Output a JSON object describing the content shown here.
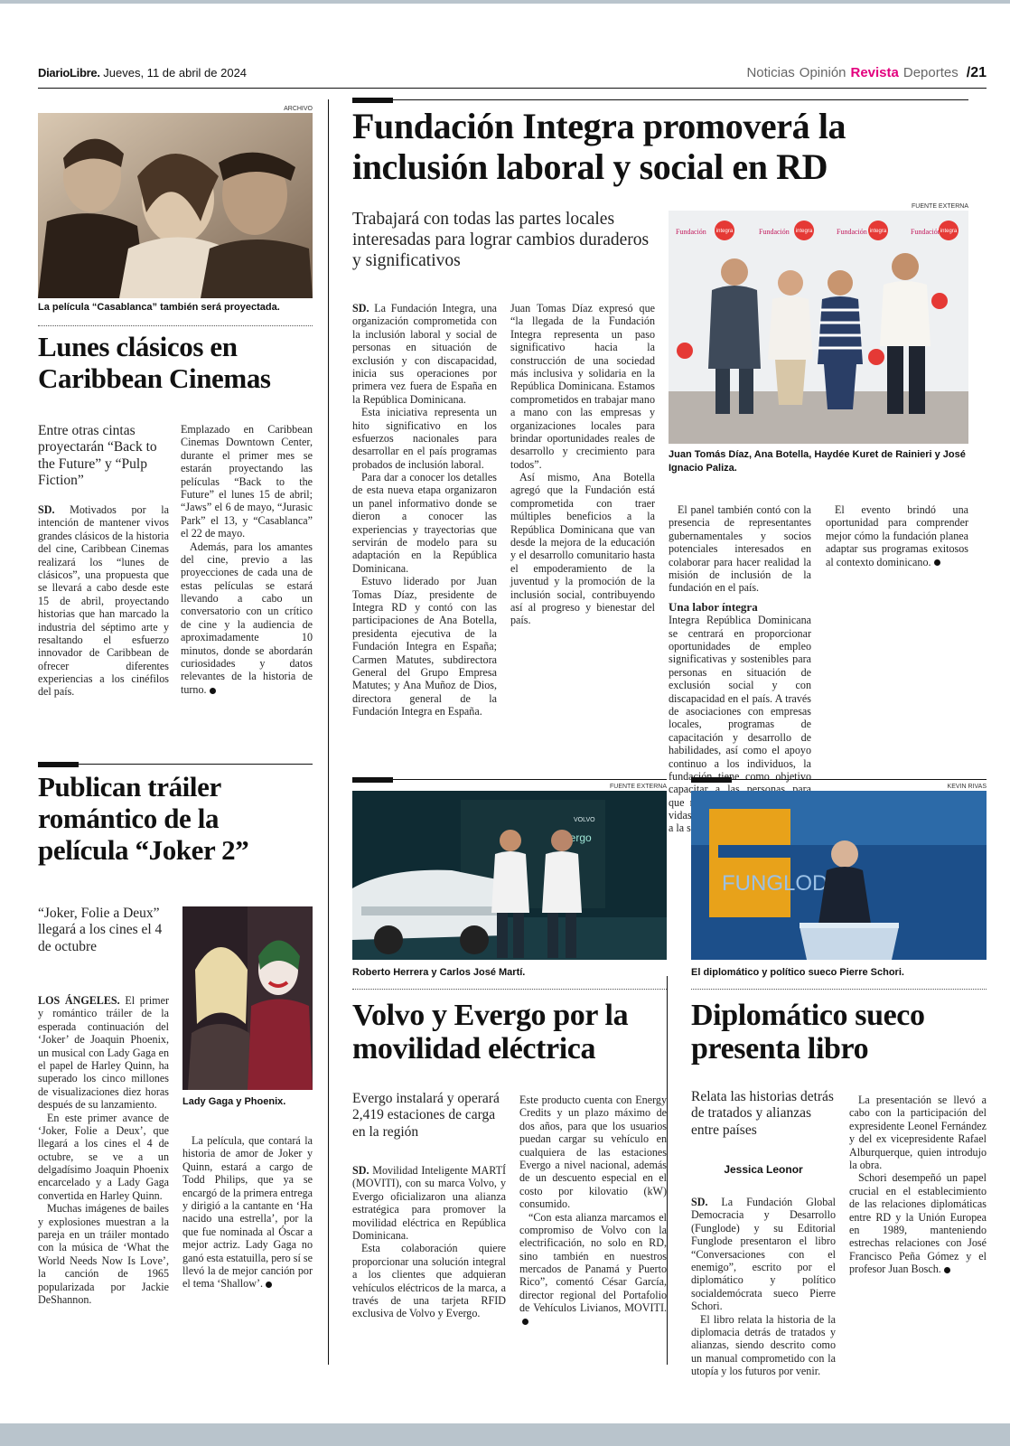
{
  "header": {
    "brand": "DiarioLibre.",
    "date": "Jueves, 11 de abril de 2024",
    "sections": [
      "Noticias",
      "Opinión",
      "Revista",
      "Deportes"
    ],
    "active_section": "Revista",
    "page": "/21"
  },
  "casablanca": {
    "credit": "ARCHIVO",
    "caption": "La película “Casablanca” también será proyectada.",
    "headline": "Lunes clásicos en Caribbean Cinemas",
    "deck": "Entre otras cintas proyectarán “Back to the Future” y “Pulp Fiction”",
    "dateline": "SD.",
    "p1": "Motivados por la intención de mantener vivos grandes clásicos de la historia del cine, Caribbean Cinemas realizará los “lunes de clásicos”, una propuesta que se llevará a cabo desde este 15 de abril, proyectando historias que han marcado la industria del séptimo arte y resaltando el esfuerzo innovador de Caribbean de ofrecer diferentes experiencias a los cinéfilos del país.",
    "p2": "Emplazado en Caribbean Cinemas Downtown Center, durante el primer mes se estarán proyectando las películas “Back to the Future” el lunes 15 de abril; “Jaws” el 6 de mayo, “Jurasic Park” el 13, y “Casablanca” el 22 de mayo.",
    "p3": "Además, para los amantes del cine, previo a las proyecciones de cada una de estas películas se estará llevando a cabo un conversatorio con un crítico de cine y la audiencia de aproximadamente 10 minutos, donde se abordarán curiosidades y datos relevantes de la historia de turno."
  },
  "integra": {
    "headline": "Fundación Integra promoverá la inclusión laboral y social en RD",
    "deck": "Trabajará con todas las partes locales interesadas para lograr cambios duraderos y significativos",
    "credit": "FUENTE EXTERNA",
    "caption": "Juan Tomás Díaz, Ana Botella, Haydée Kuret de Rainieri y José Ignacio Paliza.",
    "dateline": "SD.",
    "p1": "La Fundación Integra, una organización comprometida con la inclusión laboral y social de personas en situación de exclusión y con discapacidad, inicia sus operaciones por primera vez fuera de España en la República Dominicana.",
    "p2": "Esta iniciativa representa un hito significativo en los esfuerzos nacionales para desarrollar en el país programas probados de inclusión laboral.",
    "p3": "Para dar a conocer los detalles de esta nueva etapa organizaron un panel informativo donde se dieron a conocer las experiencias y trayectorias que servirán de modelo para su adaptación en la República Dominicana.",
    "p4": "Estuvo liderado por Juan Tomas Díaz, presidente de Integra RD y contó con las participaciones de Ana Botella, presidenta ejecutiva de la Fundación Integra en España; Carmen Matutes, subdirectora General del Grupo Empresa Matutes; y Ana Muñoz de Dios, directora general de la Fundación Integra en España.",
    "p5": "Juan Tomas Díaz expresó que “la llegada de la Fundación Integra representa un paso significativo hacia la construcción de una sociedad más inclusiva y solidaria en la República Dominicana. Estamos comprometidos en trabajar mano a mano con las empresas y organizaciones locales para brindar oportunidades reales de desarrollo y crecimiento para todos”.",
    "p6": "Así mismo, Ana Botella agregó que la Fundación está comprometida con traer múltiples beneficios a la República Dominicana que van desde la mejora de la educación y el desarrollo comunitario hasta el empoderamiento de la juventud y la promoción de la inclusión social, contribuyendo así al progreso y bienestar del país.",
    "p7": "El panel también contó con la presencia de representantes gubernamentales y socios potenciales interesados en colaborar para hacer realidad la misión de inclusión de la fundación en el país.",
    "subhead": "Una labor íntegra",
    "p8": "Integra República Dominicana se centrará en proporcionar oportunidades de empleo significativas y sostenibles para personas en situación de exclusión social y con discapacidad en el país. A través de asociaciones con empresas locales, programas de capacitación y desarrollo de habilidades, así como el apoyo continuo a los individuos, la fundación tiene como objetivo capacitar a las personas para que retomen el control de sus vidas y contribuyan activamente a la sociedad.",
    "p9": "El evento brindó una oportunidad para comprender mejor cómo la fundación planea adaptar sus programas exitosos al contexto dominicano.",
    "banner_word": "Fundación",
    "logo_word": "integra"
  },
  "joker": {
    "headline": "Publican tráiler romántico de la película “Joker 2”",
    "deck": "“Joker, Folie a Deux” llegará a los cines el 4 de octubre",
    "caption": "Lady Gaga y Phoenix.",
    "dateline": "LOS ÁNGELES.",
    "p1": "El primer y romántico tráiler de la esperada continuación del ‘Joker’ de Joaquin Phoenix, un musical con Lady Gaga en el papel de Harley Quinn, ha superado los cinco millones de visualizaciones diez horas después de su lanzamiento.",
    "p2": "En este primer avance de ‘Joker, Folie a Deux’, que llegará a los cines el 4 de octubre, se ve a un delgadísimo Joaquin Phoenix encarcelado y a Lady Gaga convertida en Harley Quinn.",
    "p3": "Muchas imágenes de bailes y explosiones muestran a la pareja en un tráiler montado con la música de ‘What the World Needs Now Is Love’, la canción de 1965 popularizada por Jackie DeShannon.",
    "p4": "La película, que contará la historia de amor de Joker y Quinn, estará a cargo de Todd Philips, que ya se encargó de la primera entrega y dirigió a la cantante en ‘Ha nacido una estrella’, por la que fue nominada al Óscar a mejor actriz. Lady Gaga no ganó esta estatuilla, pero sí se llevó la de mejor canción por el tema ‘Shallow’."
  },
  "volvo": {
    "credit": "FUENTE EXTERNA",
    "caption": "Roberto Herrera y Carlos José Martí.",
    "headline": "Volvo y Evergo por la movilidad eléctrica",
    "deck": "Evergo instalará y operará 2,419 estaciones de carga en la región",
    "dateline": "SD.",
    "p1": "Movilidad Inteligente MARTÍ (MOVITI), con su marca Volvo, y Evergo oficializaron una alianza estratégica para promover la movilidad eléctrica en República Dominicana.",
    "p2": "Esta colaboración quiere proporcionar una solución integral a los clientes que adquieran vehículos eléctricos de la marca, a través de una tarjeta RFID exclusiva de Volvo y Evergo.",
    "p3": "Este producto cuenta con Energy Credits y un plazo máximo de dos años, para que los usuarios puedan cargar su vehículo en cualquiera de las estaciones Evergo a nivel nacional, además de un descuento especial en el costo por kilovatio (kW) consumido.",
    "p4": "“Con esta alianza marcamos el compromiso de Volvo con la electrificación, no solo en RD, sino también en nuestros mercados de Panamá y Puerto Rico”, comentó César García, director regional del Portafolio de Vehículos Livianos, MOVITI.",
    "sign_brand": "VOLVO",
    "sign_evergo": "evergo"
  },
  "schori": {
    "credit": "KEVIN RIVAS",
    "caption": "El diplomático y político sueco Pierre Schori.",
    "headline": "Diplomático sueco presenta libro",
    "deck": "Relata las historias detrás de tratados y alianzas entre países",
    "byline": "Jessica Leonor",
    "dateline": "SD.",
    "p1": "La Fundación Global Democracia y Desarrollo (Funglode) y su Editorial Funglode presentaron el libro “Conversaciones con el enemigo”, escrito por el diplomático y político socialdemócrata sueco Pierre Schori.",
    "p2": "El libro relata la historia de la diplomacia detrás de tratados y alianzas, siendo descrito como un manual comprometido con la utopía y los futuros por venir.",
    "p3": "La presentación se llevó a cabo con la participación del expresidente Leonel Fernández y del ex vicepresidente Rafael Alburquerque, quien introdujo la obra.",
    "p4": "Schori desempeñó un papel crucial en el establecimiento de las relaciones diplomáticas entre RD y la Unión Europea en 1989, manteniendo estrechas relaciones con José Francisco Peña Gómez y el profesor Juan Bosch.",
    "backdrop": "FUNGLODE"
  }
}
